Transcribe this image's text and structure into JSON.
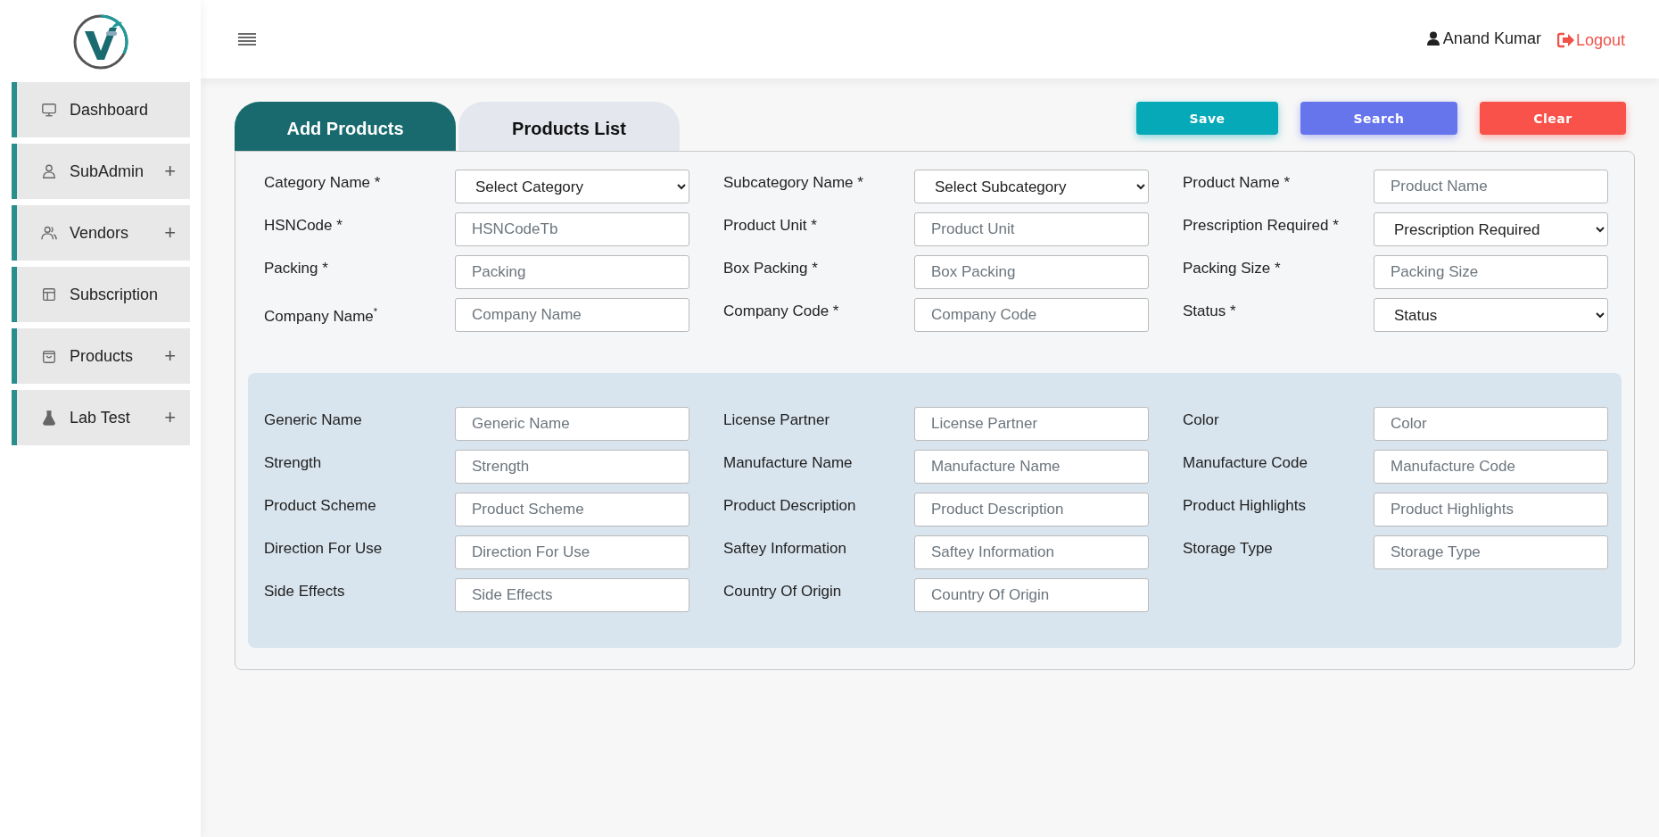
{
  "sidebar": {
    "items": [
      {
        "label": "Dashboard"
      },
      {
        "label": "SubAdmin",
        "expander": "+"
      },
      {
        "label": "Vendors",
        "expander": "+"
      },
      {
        "label": "Subscription"
      },
      {
        "label": "Products",
        "expander": "+"
      },
      {
        "label": "Lab Test",
        "expander": "+"
      }
    ]
  },
  "header": {
    "user": "Anand Kumar",
    "logout": "Logout"
  },
  "tabs": [
    {
      "label": "Add Products",
      "selected": true
    },
    {
      "label": "Products List",
      "selected": false
    }
  ],
  "buttons": [
    {
      "label": "Save",
      "kind": "save"
    },
    {
      "label": "Search",
      "kind": "search"
    },
    {
      "label": "Clear",
      "kind": "clear"
    }
  ],
  "main_fields": [
    {
      "label": "Category Name *",
      "kind": "select",
      "value": "Select Category"
    },
    {
      "label": "Subcategory Name *",
      "kind": "select",
      "value": "Select Subcategory"
    },
    {
      "label": "Product Name *",
      "kind": "input",
      "placeholder": "Product Name"
    },
    {
      "label": "HSNCode *",
      "kind": "input",
      "placeholder": "HSNCodeTb"
    },
    {
      "label": "Product Unit *",
      "kind": "input",
      "placeholder": "Product Unit"
    },
    {
      "label": "Prescription Required *",
      "kind": "select",
      "value": "Prescription Required"
    },
    {
      "label": "Packing *",
      "kind": "input",
      "placeholder": "Packing"
    },
    {
      "label": "Box Packing *",
      "kind": "input",
      "placeholder": "Box Packing"
    },
    {
      "label": "Packing Size *",
      "kind": "input",
      "placeholder": "Packing Size"
    },
    {
      "label": "Company Name$^{*}$",
      "kind": "input",
      "placeholder": "Company Name"
    },
    {
      "label": "Company Code *",
      "kind": "input",
      "placeholder": "Company Code"
    },
    {
      "label": "Status *",
      "kind": "select",
      "value": "Status"
    }
  ],
  "extra_fields": [
    {
      "label": "Generic Name",
      "kind": "input",
      "placeholder": "Generic Name"
    },
    {
      "label": "License Partner",
      "kind": "input",
      "placeholder": "License Partner"
    },
    {
      "label": "Color",
      "kind": "input",
      "placeholder": "Color"
    },
    {
      "label": "Strength",
      "kind": "input",
      "placeholder": "Strength"
    },
    {
      "label": "Manufacture Name",
      "kind": "input",
      "placeholder": "Manufacture Name"
    },
    {
      "label": "Manufacture Code",
      "kind": "input",
      "placeholder": "Manufacture Code"
    },
    {
      "label": "Product Scheme",
      "kind": "input",
      "placeholder": "Product Scheme"
    },
    {
      "label": "Product Description",
      "kind": "input",
      "placeholder": "Product Description"
    },
    {
      "label": "Product Highlights",
      "kind": "input",
      "placeholder": "Product Highlights"
    },
    {
      "label": "Direction For Use",
      "kind": "input",
      "placeholder": "Direction For Use"
    },
    {
      "label": "Saftey Information",
      "kind": "input",
      "placeholder": "Saftey Information"
    },
    {
      "label": "Storage Type",
      "kind": "input",
      "placeholder": "Storage Type"
    },
    {
      "label": "Side Effects",
      "kind": "input",
      "placeholder": "Side Effects"
    },
    {
      "label": "Country Of Origin",
      "kind": "input",
      "placeholder": "Country Of Origin"
    }
  ]
}
